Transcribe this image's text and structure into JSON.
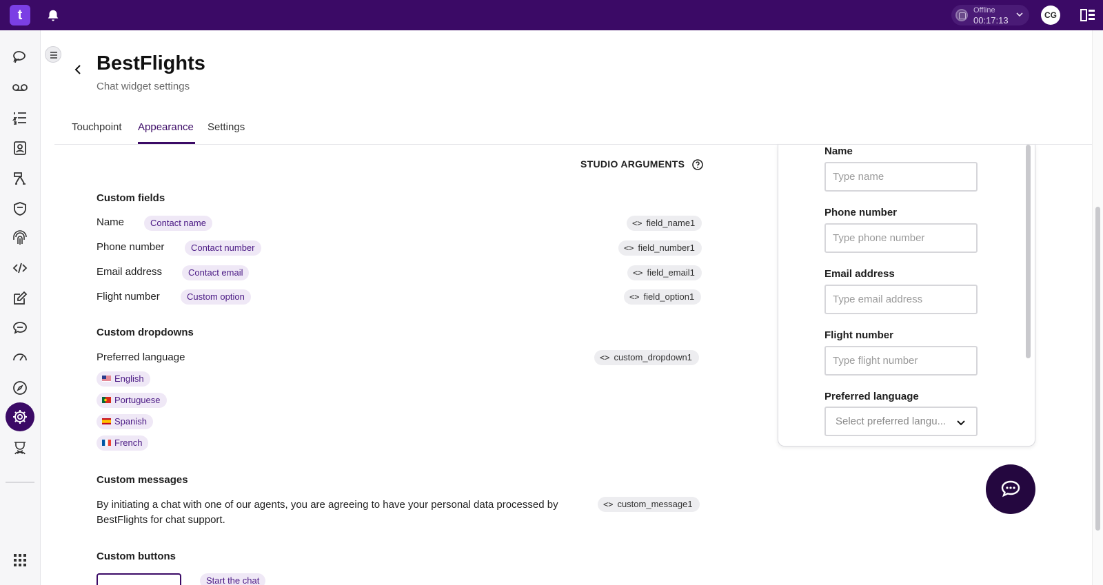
{
  "topbar": {
    "logo_text": "t",
    "status_label": "Offline",
    "status_time": "00:17:13",
    "avatar_initials": "CG"
  },
  "header": {
    "title": "BestFlights",
    "subtitle": "Chat widget settings"
  },
  "tabs": [
    {
      "label": "Touchpoint"
    },
    {
      "label": "Appearance",
      "active": true
    },
    {
      "label": "Settings"
    }
  ],
  "studio_arguments_label": "STUDIO ARGUMENTS",
  "custom_fields": {
    "title": "Custom fields",
    "items": [
      {
        "label": "Name",
        "chip": "Contact name",
        "arg": "field_name1"
      },
      {
        "label": "Phone number",
        "chip": "Contact number",
        "arg": "field_number1"
      },
      {
        "label": "Email address",
        "chip": "Contact email",
        "arg": "field_email1"
      },
      {
        "label": "Flight number",
        "chip": "Custom option",
        "arg": "field_option1"
      }
    ]
  },
  "custom_dropdowns": {
    "title": "Custom dropdowns",
    "label": "Preferred language",
    "arg": "custom_dropdown1",
    "options": [
      {
        "label": "English",
        "flag": "us-flag"
      },
      {
        "label": "Portuguese",
        "flag": "pt-flag"
      },
      {
        "label": "Spanish",
        "flag": "es-flag"
      },
      {
        "label": "French",
        "flag": "fr-flag"
      }
    ]
  },
  "custom_messages": {
    "title": "Custom messages",
    "text": "By initiating a chat with one of our agents, you are agreeing to have your personal data processed by BestFlights for chat support.",
    "arg": "custom_message1"
  },
  "custom_buttons": {
    "title": "Custom buttons",
    "chip": "Start the chat"
  },
  "preview": {
    "fields": [
      {
        "label": "Name",
        "placeholder": "Type name"
      },
      {
        "label": "Phone number",
        "placeholder": "Type phone number"
      },
      {
        "label": "Email address",
        "placeholder": "Type email address"
      },
      {
        "label": "Flight number",
        "placeholder": "Type flight number"
      }
    ],
    "select_label": "Preferred language",
    "select_placeholder": "Select preferred langu..."
  },
  "colors": {
    "brand": "#3b0a66",
    "chip_bg": "#efe8f6",
    "chip_text": "#4b1a85",
    "fab": "#24073f"
  }
}
